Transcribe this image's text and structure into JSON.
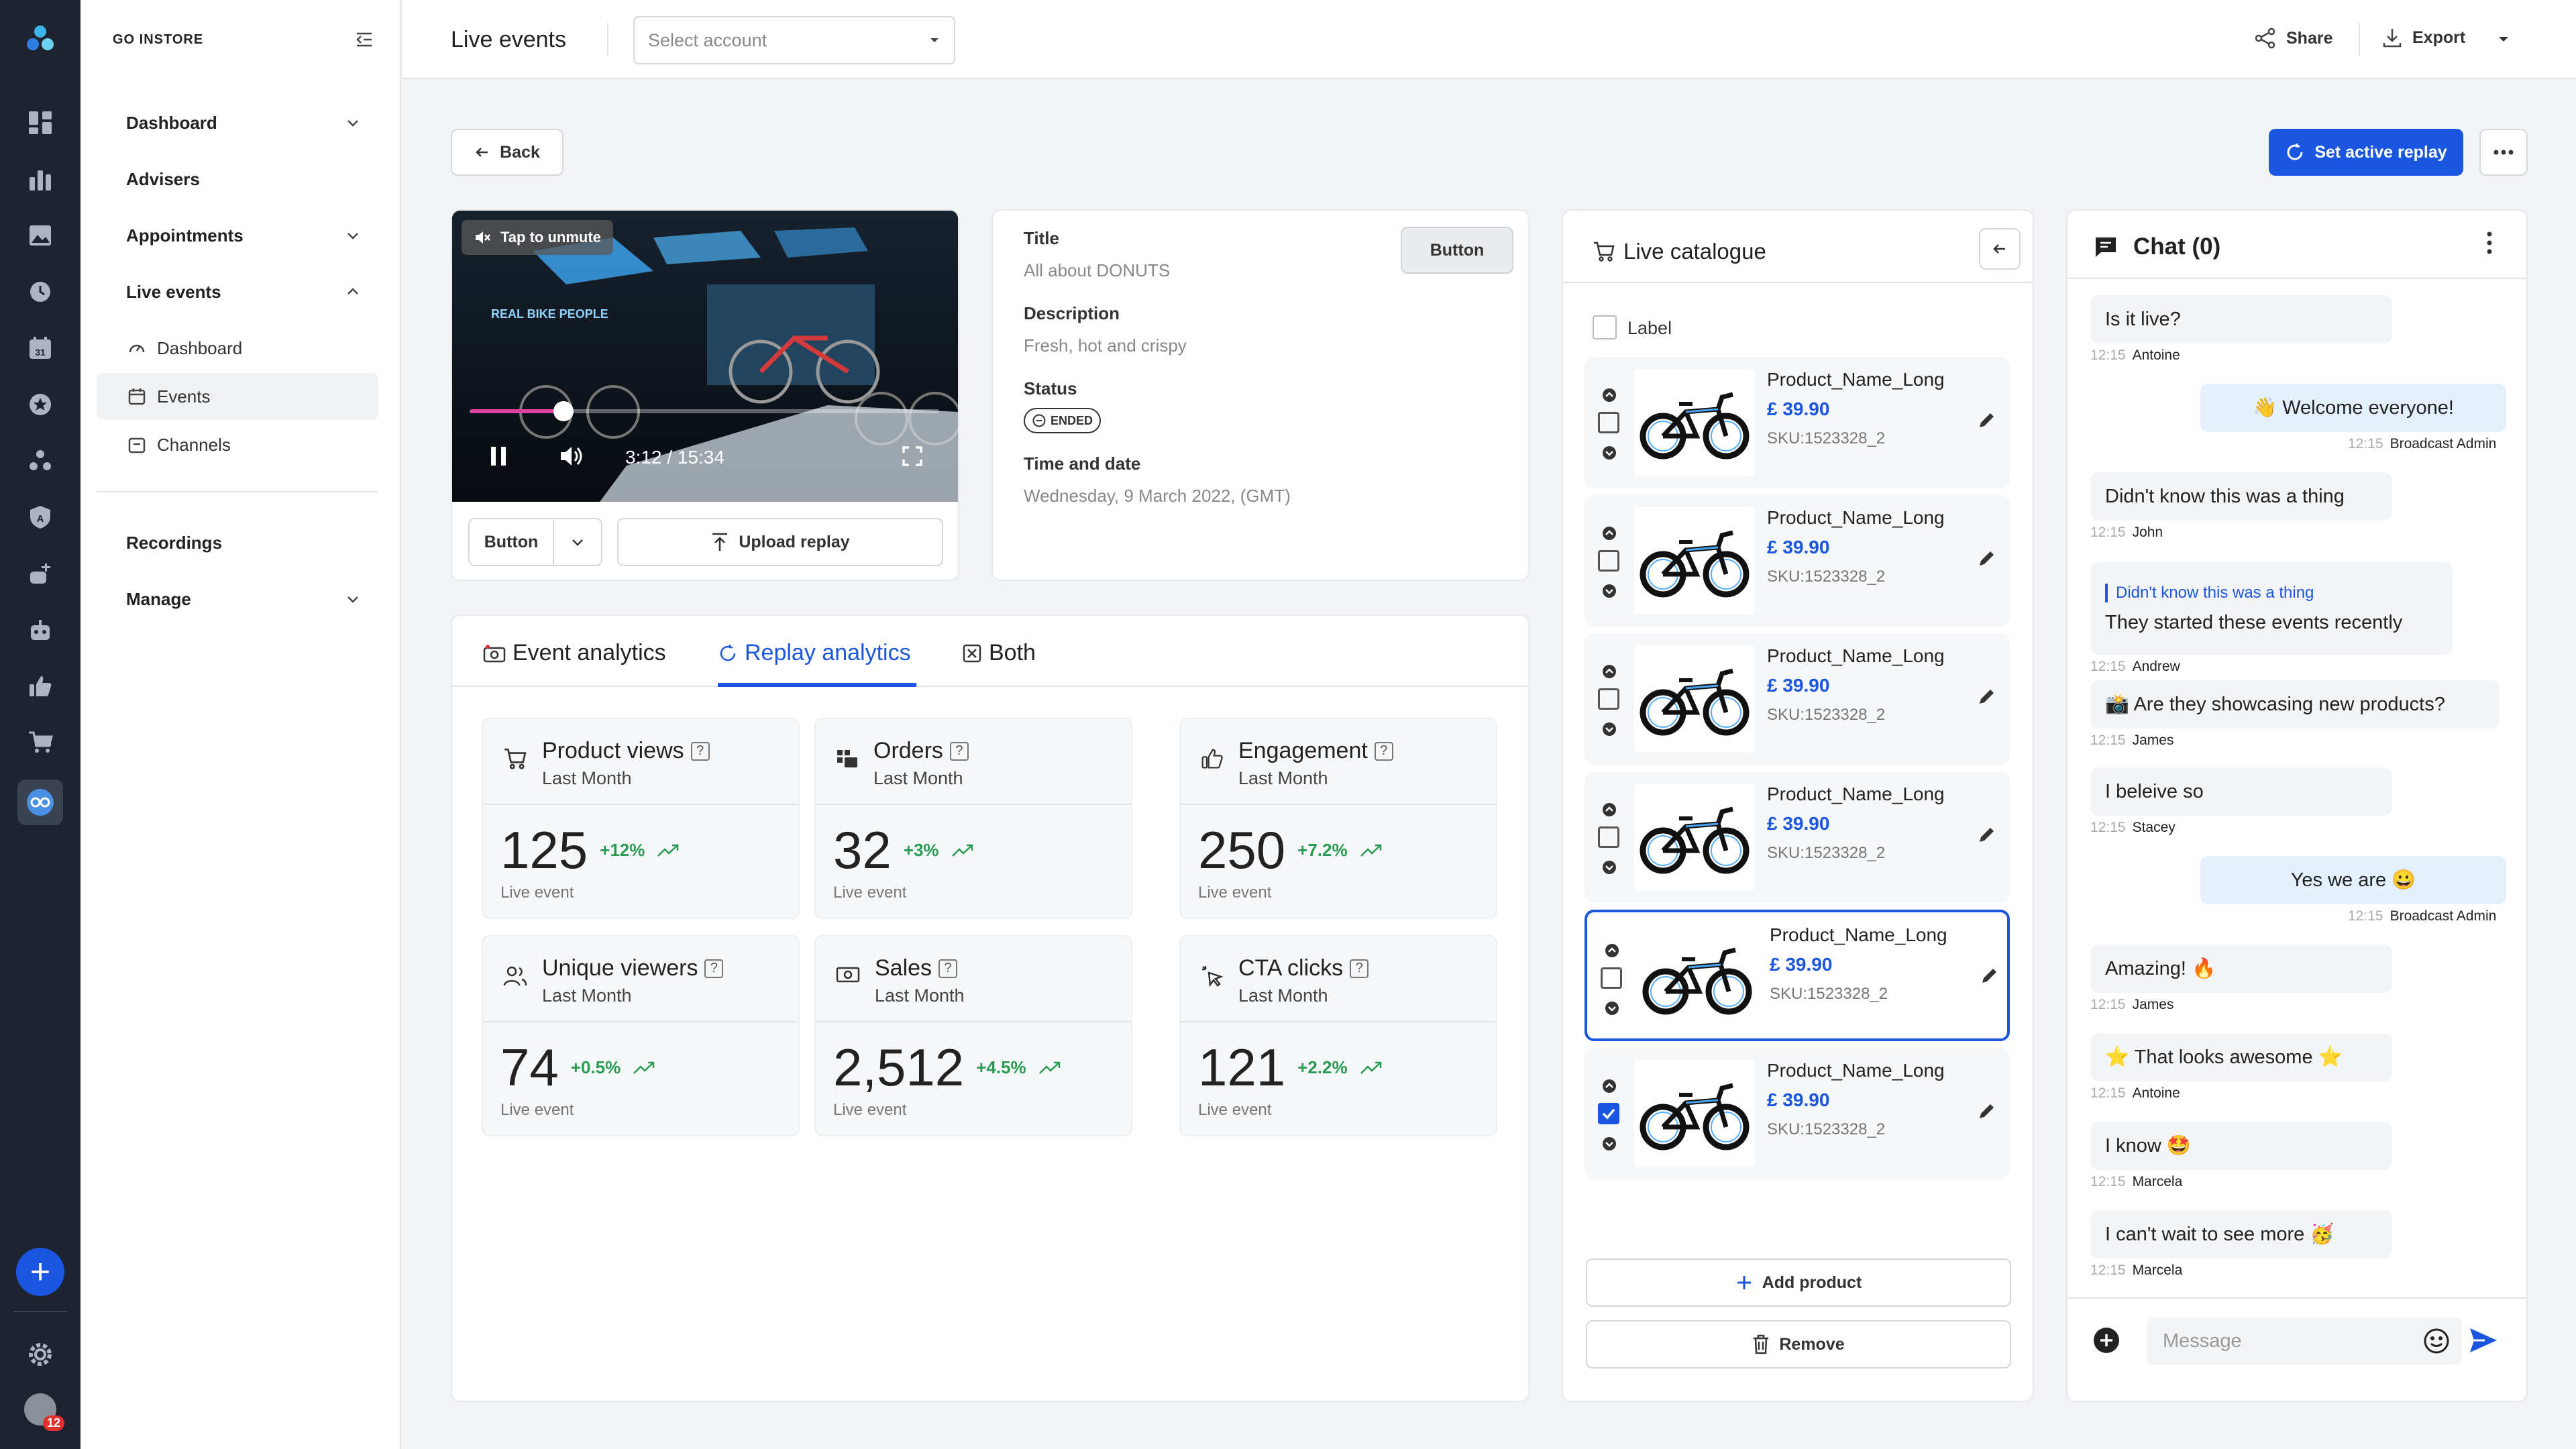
{
  "brand": "GO INSTORE",
  "topbar": {
    "title": "Live events",
    "account_placeholder": "Select account",
    "share": "Share",
    "export": "Export"
  },
  "nav": {
    "dashboard": "Dashboard",
    "advisers": "Advisers",
    "appointments": "Appointments",
    "live_events": "Live events",
    "sub": [
      "Dashboard",
      "Events",
      "Channels"
    ],
    "recordings": "Recordings",
    "manage": "Manage"
  },
  "rail": {
    "badge": "12"
  },
  "actions": {
    "back": "Back",
    "set_active": "Set active replay"
  },
  "video": {
    "unmute": "Tap to unmute",
    "time": "3:12 / 15:34",
    "progress": 0.2,
    "button": "Button",
    "upload": "Upload replay"
  },
  "details": {
    "button": "Button",
    "title_label": "Title",
    "title_value": "All about DONUTS",
    "desc_label": "Description",
    "desc_value": "Fresh, hot and crispy",
    "status_label": "Status",
    "status_value": "ENDED",
    "time_label": "Time and date",
    "time_value": "Wednesday, 9 March 2022, (GMT)"
  },
  "tabs": [
    "Event analytics",
    "Replay analytics",
    "Both"
  ],
  "stats": [
    {
      "title": "Product views",
      "sub": "Last Month",
      "value": "125",
      "change": "+12%",
      "foot": "Live event",
      "icon": "cart-icon"
    },
    {
      "title": "Orders",
      "sub": "Last Month",
      "value": "32",
      "change": "+3%",
      "foot": "Live event",
      "icon": "orders-icon"
    },
    {
      "title": "Engagement",
      "sub": "Last Month",
      "value": "250",
      "change": "+7.2%",
      "foot": "Live event",
      "icon": "thumbs-up-icon"
    },
    {
      "title": "Unique viewers",
      "sub": "Last Month",
      "value": "74",
      "change": "+0.5%",
      "foot": "Live event",
      "icon": "users-icon"
    },
    {
      "title": "Sales",
      "sub": "Last Month",
      "value": "2,512",
      "change": "+4.5%",
      "foot": "Live event",
      "icon": "money-icon"
    },
    {
      "title": "CTA clicks",
      "sub": "Last Month",
      "value": "121",
      "change": "+2.2%",
      "foot": "Live event",
      "icon": "cursor-click-icon"
    }
  ],
  "catalogue": {
    "title": "Live catalogue",
    "label": "Label",
    "products": [
      {
        "name": "Product_Name_Long",
        "price": "£ 39.90",
        "sku": "SKU:1523328_2"
      },
      {
        "name": "Product_Name_Long",
        "price": "£ 39.90",
        "sku": "SKU:1523328_2"
      },
      {
        "name": "Product_Name_Long",
        "price": "£ 39.90",
        "sku": "SKU:1523328_2"
      },
      {
        "name": "Product_Name_Long",
        "price": "£ 39.90",
        "sku": "SKU:1523328_2"
      },
      {
        "name": "Product_Name_Long",
        "price": "£ 39.90",
        "sku": "SKU:1523328_2"
      },
      {
        "name": "Product_Name_Long",
        "price": "£ 39.90",
        "sku": "SKU:1523328_2"
      }
    ],
    "add": "Add product",
    "remove": "Remove"
  },
  "chat": {
    "title": "Chat (0)",
    "placeholder": "Message",
    "messages": [
      {
        "text": "Is it live?",
        "time": "12:15",
        "author": "Antoine"
      },
      {
        "text": "👋 Welcome everyone!",
        "time": "12:15",
        "author": "Broadcast Admin"
      },
      {
        "text": "Didn't know this was a thing",
        "time": "12:15",
        "author": "John"
      },
      {
        "quote": "Didn't know this was a thing",
        "text": "They started these events recently",
        "time": "12:15",
        "author": "Andrew"
      },
      {
        "text": "📸 Are they showcasing new products?",
        "time": "12:15",
        "author": "James"
      },
      {
        "text": "I beleive so",
        "time": "12:15",
        "author": "Stacey"
      },
      {
        "text": "Yes we are 😀",
        "time": "12:15",
        "author": "Broadcast Admin"
      },
      {
        "text": "Amazing! 🔥",
        "time": "12:15",
        "author": "James"
      },
      {
        "text": "⭐ That looks awesome ⭐",
        "time": "12:15",
        "author": "Antoine"
      },
      {
        "text": "I know 🤩",
        "time": "12:15",
        "author": "Marcela"
      },
      {
        "text": "I can't wait to see more 🥳",
        "time": "12:15",
        "author": "Marcela"
      }
    ]
  }
}
